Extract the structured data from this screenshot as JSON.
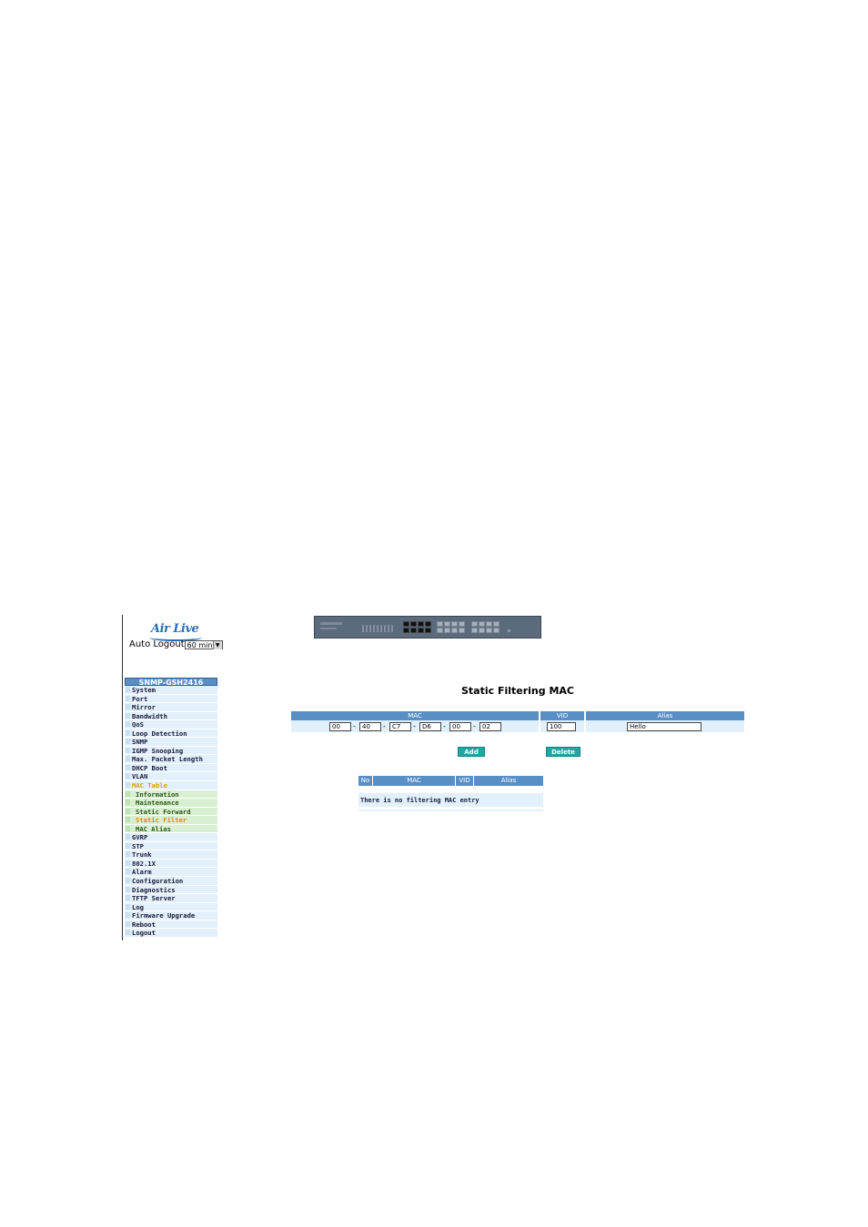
{
  "logo": {
    "text": "Air Live"
  },
  "auto_logout": {
    "label": "Auto Logout",
    "value": "60 min"
  },
  "sidebar": {
    "title": "SNMP-GSH2416",
    "items": [
      {
        "label": "System"
      },
      {
        "label": "Port"
      },
      {
        "label": "Mirror"
      },
      {
        "label": "Bandwidth"
      },
      {
        "label": "QoS"
      },
      {
        "label": "Loop Detection"
      },
      {
        "label": "SNMP"
      },
      {
        "label": "IGMP Snooping"
      },
      {
        "label": "Max. Packet Length"
      },
      {
        "label": "DHCP Boot"
      },
      {
        "label": "VLAN"
      },
      {
        "label": "MAC Table"
      },
      {
        "label": "Information"
      },
      {
        "label": "Maintenance"
      },
      {
        "label": "Static Forward"
      },
      {
        "label": "Static Filter"
      },
      {
        "label": "MAC Alias"
      },
      {
        "label": "GVRP"
      },
      {
        "label": "STP"
      },
      {
        "label": "Trunk"
      },
      {
        "label": "802.1X"
      },
      {
        "label": "Alarm"
      },
      {
        "label": "Configuration"
      },
      {
        "label": "Diagnostics"
      },
      {
        "label": "TFTP Server"
      },
      {
        "label": "Log"
      },
      {
        "label": "Firmware Upgrade"
      },
      {
        "label": "Reboot"
      },
      {
        "label": "Logout"
      }
    ]
  },
  "page": {
    "title": "Static Filtering MAC"
  },
  "form": {
    "headers": {
      "mac": "MAC",
      "vid": "VID",
      "alias": "Alias"
    },
    "mac": [
      "00",
      "40",
      "C7",
      "D6",
      "00",
      "02"
    ],
    "separator": "-",
    "vid": "100",
    "alias": "Hello",
    "add_label": "Add",
    "delete_label": "Delete"
  },
  "list": {
    "headers": {
      "no": "No",
      "mac": "MAC",
      "vid": "VID",
      "alias": "Alias"
    },
    "empty_text": "There is no filtering MAC entry"
  },
  "colors": {
    "header_blue": "#5a8fc6",
    "row_light": "#e1f0fb",
    "button_teal": "#1fa7a3",
    "sub_green": "#d9efd2"
  }
}
